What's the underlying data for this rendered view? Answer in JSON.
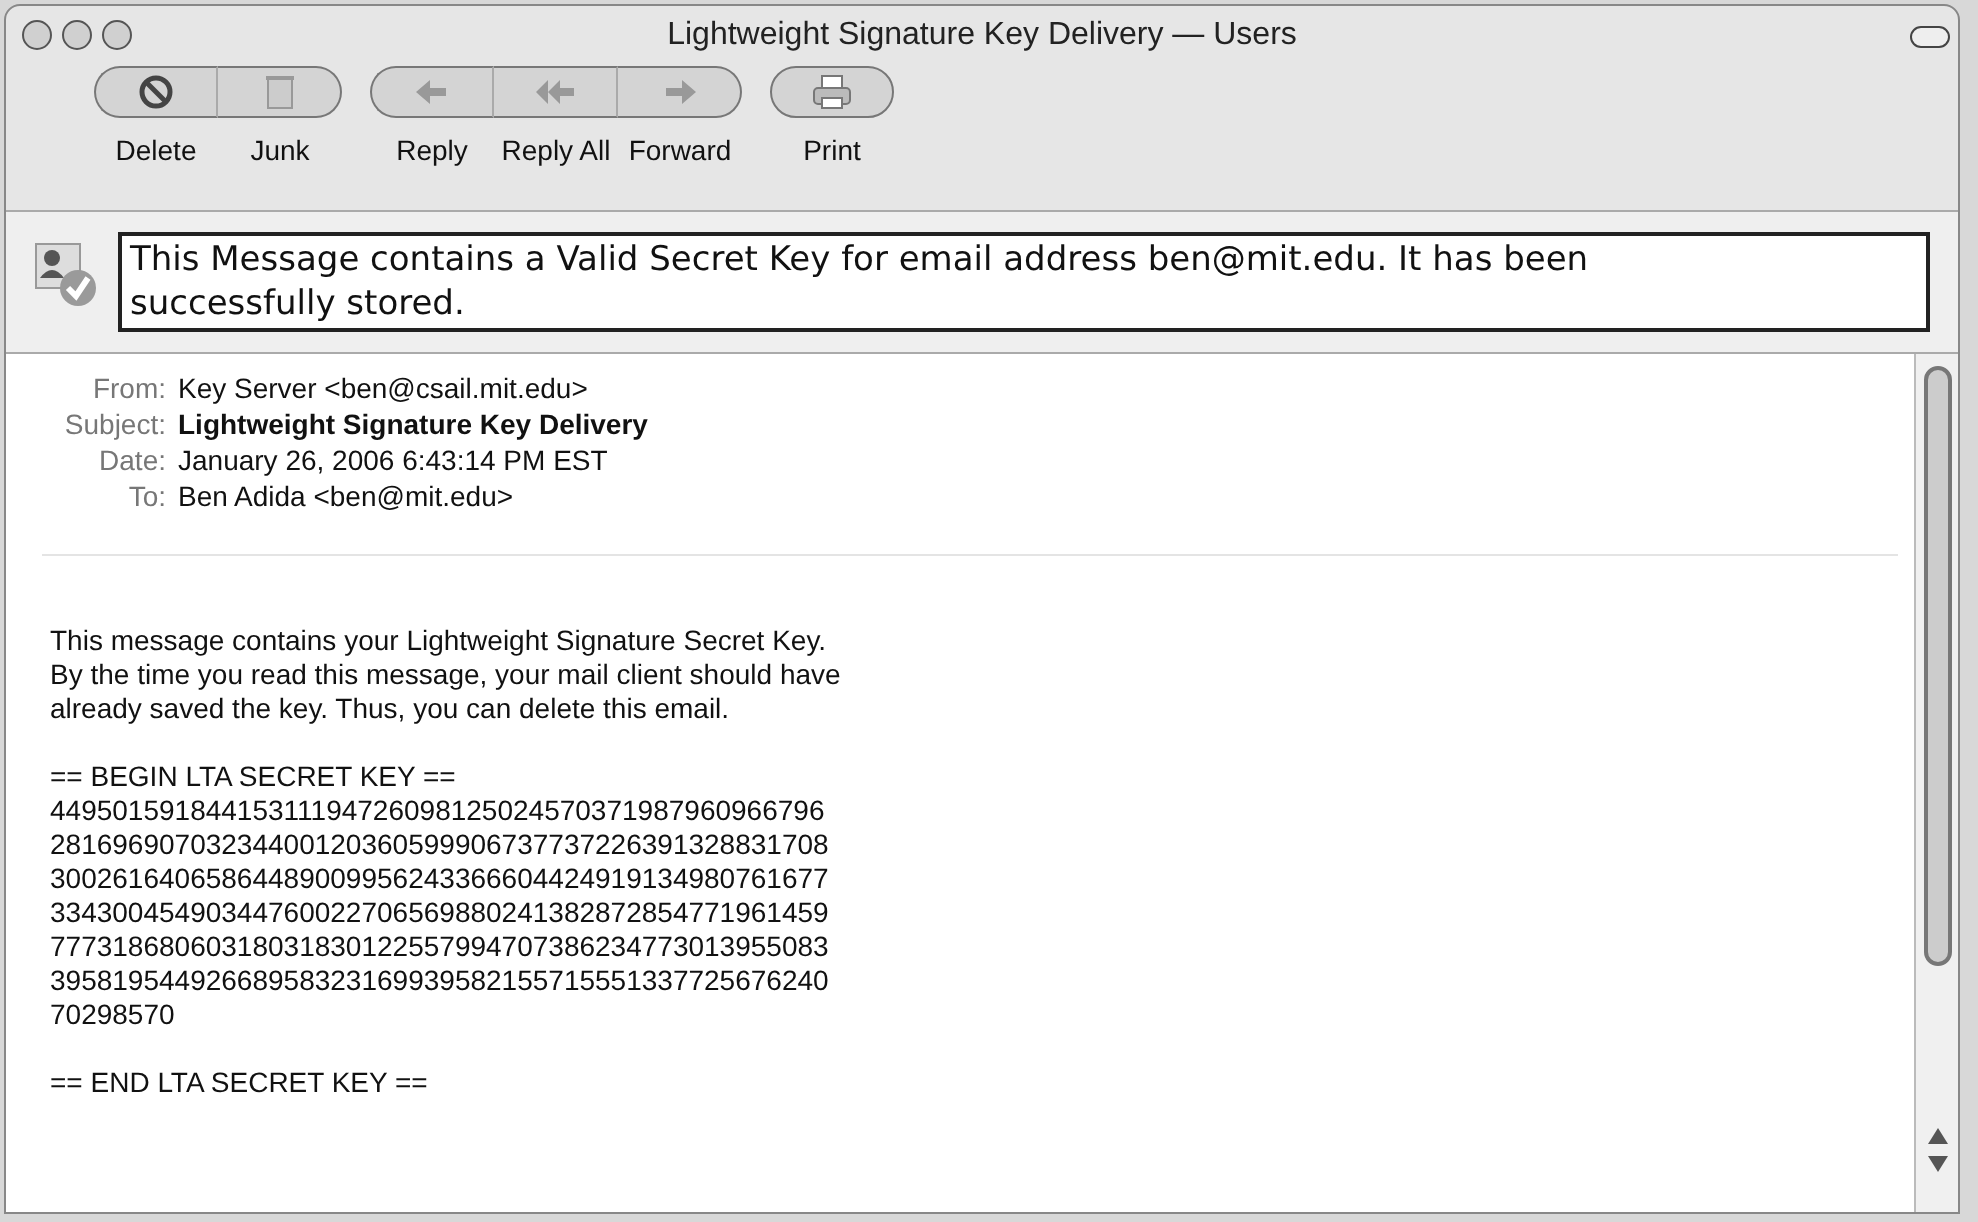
{
  "window": {
    "title": "Lightweight Signature Key Delivery — Users"
  },
  "toolbar": {
    "groups": [
      {
        "buttons": [
          {
            "kind": "delete",
            "label": "Delete"
          },
          {
            "kind": "junk",
            "label": "Junk"
          }
        ]
      },
      {
        "buttons": [
          {
            "kind": "reply",
            "label": "Reply"
          },
          {
            "kind": "reply_all",
            "label": "Reply All"
          },
          {
            "kind": "forward",
            "label": "Forward"
          }
        ]
      },
      {
        "buttons": [
          {
            "kind": "print",
            "label": "Print"
          }
        ]
      }
    ]
  },
  "banner": {
    "text": "This Message contains a Valid Secret Key for email address ben@mit.edu. It has been successfully stored."
  },
  "headers": [
    {
      "label": "From:",
      "value": "Key Server <ben@csail.mit.edu>",
      "bold": false
    },
    {
      "label": "Subject:",
      "value": "Lightweight Signature Key Delivery",
      "bold": true
    },
    {
      "label": "Date:",
      "value": "January 26, 2006 6:43:14 PM EST",
      "bold": false
    },
    {
      "label": "To:",
      "value": "Ben Adida <ben@mit.edu>",
      "bold": false
    }
  ],
  "body": {
    "intro": [
      "This message contains your Lightweight Signature Secret Key.",
      "By the time you read this message, your mail client should have",
      "already saved the key. Thus, you can delete this email."
    ],
    "key_begin": "== BEGIN LTA SECRET KEY ==",
    "key_lines": [
      "44950159184415311194726098125024570371987960966796",
      "28169690703234400120360599906737737226391328831708",
      "30026164065864489009956243366604424919134980761677",
      "33430045490344760022706569880241382872854771961459",
      "77731868060318031830122557994707386234773013955083",
      "39581954492668958323169939582155715551337725676240",
      "70298570"
    ],
    "key_end": "== END LTA SECRET KEY =="
  }
}
